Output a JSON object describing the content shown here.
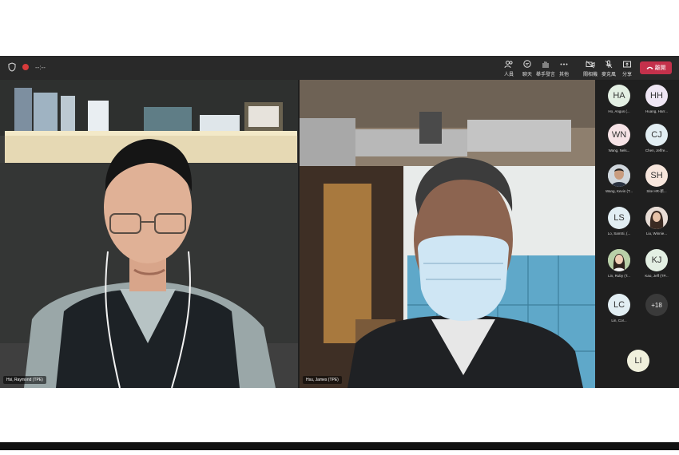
{
  "toolbar": {
    "timer": "--:--",
    "buttons": [
      {
        "label": "人員",
        "icon": "people-icon"
      },
      {
        "label": "聊天",
        "icon": "chat-icon"
      },
      {
        "label": "舉手發言",
        "icon": "raise-hand-icon"
      },
      {
        "label": "其他",
        "icon": "more-icon"
      },
      {
        "label": "關相機",
        "icon": "camera-icon"
      },
      {
        "label": "麥克風",
        "icon": "microphone-icon"
      },
      {
        "label": "分享",
        "icon": "share-icon"
      }
    ],
    "leave_label": "離開"
  },
  "tiles": {
    "left_name": "Hsi, Raymond (TPE)",
    "right_name": "Hsu, James (TPE)"
  },
  "roster": {
    "participants": [
      {
        "initials": "HA",
        "name": "Ho, Angus (...",
        "color": "#e3efe3"
      },
      {
        "initials": "HH",
        "name": "Huang, Harr...",
        "color": "#efe6f4"
      },
      {
        "initials": "WN",
        "name": "Wang, Nels...",
        "color": "#f6e3e6"
      },
      {
        "initials": "CJ",
        "name": "Chen, Jeffre...",
        "color": "#e2eef3"
      },
      {
        "initials": "",
        "name": "Wang, Kevin (T...",
        "color": "#cfd6dc"
      },
      {
        "initials": "SH",
        "name": "Site HR-新...",
        "color": "#f7e6dc"
      },
      {
        "initials": "LS",
        "name": "Lo, SamSi, (...",
        "color": "#e2eef3"
      },
      {
        "initials": "",
        "name": "Liu, Winnie...",
        "color": "#d9cfc8"
      },
      {
        "initials": "",
        "name": "Lin, Ruby (T...",
        "color": "#cbd8c2"
      },
      {
        "initials": "KJ",
        "name": "Kao, Jeff (TP...",
        "color": "#e3efe3"
      },
      {
        "initials": "LC",
        "name": "Lin, Cor...",
        "color": "#e2eef3"
      },
      {
        "initials": "+18",
        "name": "",
        "color": "#3a3a3a"
      },
      {
        "initials": "LI",
        "name": "",
        "color": "#f0f0dc"
      }
    ]
  }
}
